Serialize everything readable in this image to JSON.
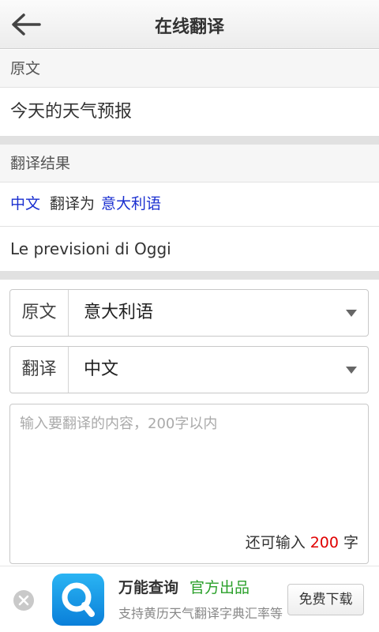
{
  "header": {
    "title": "在线翻译",
    "back_icon": "arrow-left-icon"
  },
  "source_section": {
    "label": "原文",
    "text": "今天的天气预报"
  },
  "result_section": {
    "label": "翻译结果",
    "from_lang": "中文",
    "connector": "翻译为",
    "to_lang": "意大利语",
    "text": "Le previsioni di Oggi"
  },
  "form": {
    "source_select": {
      "label": "原文",
      "value": "意大利语"
    },
    "target_select": {
      "label": "翻译",
      "value": "中文"
    },
    "input": {
      "value": "",
      "placeholder": "输入要翻译的内容，200字以内"
    },
    "counter": {
      "prefix": "还可输入",
      "remaining": "200",
      "suffix": "字"
    }
  },
  "ad": {
    "app_name": "万能查询",
    "badge": "官方出品",
    "description": "支持黄历天气翻译字典汇率等",
    "button": "免费下载"
  },
  "colors": {
    "link_blue": "#1a2fd0",
    "counter_red": "#e00000",
    "badge_green": "#2aa02a"
  }
}
